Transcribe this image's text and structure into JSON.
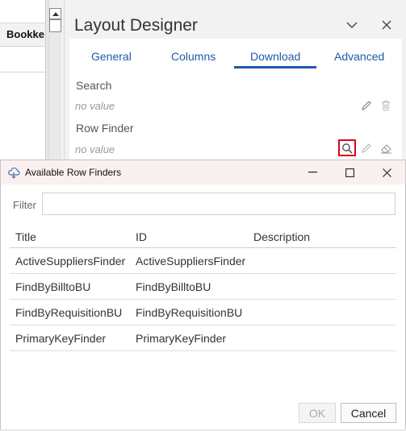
{
  "background_sheet": {
    "header_label": "Bookke"
  },
  "designer": {
    "title": "Layout Designer",
    "tabs": [
      {
        "label": "General"
      },
      {
        "label": "Columns"
      },
      {
        "label": "Download"
      },
      {
        "label": "Advanced"
      }
    ],
    "active_tab": "Download",
    "fields": [
      {
        "label": "Search",
        "value": "no value"
      },
      {
        "label": "Row Finder",
        "value": "no value"
      }
    ]
  },
  "dialog": {
    "title": "Available Row Finders",
    "filter_label": "Filter",
    "filter_value": "",
    "columns": [
      "Title",
      "ID",
      "Description"
    ],
    "rows": [
      {
        "title": "ActiveSuppliersFinder",
        "id": "ActiveSuppliersFinder",
        "description": ""
      },
      {
        "title": "FindByBilltoBU",
        "id": "FindByBilltoBU",
        "description": ""
      },
      {
        "title": "FindByRequisitionBU",
        "id": "FindByRequisitionBU",
        "description": ""
      },
      {
        "title": "PrimaryKeyFinder",
        "id": "PrimaryKeyFinder",
        "description": ""
      }
    ],
    "ok_label": "OK",
    "cancel_label": "Cancel"
  },
  "colors": {
    "accent": "#1e5aa8",
    "highlight": "#e0001b",
    "dialog_titlebar": "#f9f0ef"
  },
  "icons": [
    "scroll-up-arrow-icon",
    "chevron-down-icon",
    "close-icon",
    "pencil-icon",
    "trash-icon",
    "search-icon",
    "eraser-icon",
    "cloud-app-icon",
    "minimize-icon",
    "maximize-icon"
  ]
}
